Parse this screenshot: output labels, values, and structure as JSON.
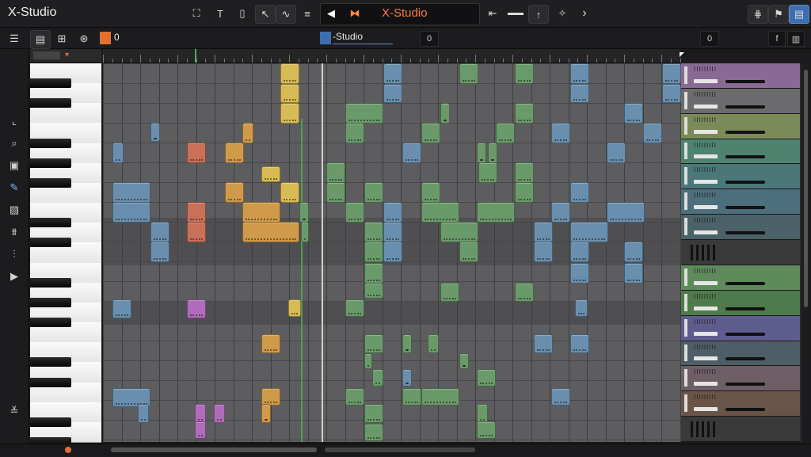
{
  "app": {
    "title": "X-Studio"
  },
  "toolbar": {
    "icons": [
      "snap-icon",
      "text-tool-icon",
      "file-icon",
      "cursor-icon",
      "wave-icon",
      "menu-icon",
      "play-back-icon",
      "play-icon",
      "rewind-icon",
      "up-icon",
      "magic-icon",
      "forward-icon",
      "split-icon",
      "flag-icon",
      "panel-icon"
    ]
  },
  "transport": {
    "title": "X-Studio"
  },
  "subbar": {
    "position": "0",
    "track_name": "-Studio",
    "field_a": "0",
    "field_b": "0",
    "fx_label": "f"
  },
  "tools": [
    "select-tool-icon",
    "zoom-tool-icon",
    "erase-tool-icon",
    "pencil-tool-icon",
    "paint-tool-icon",
    "stack-tool-icon",
    "split-tool-icon",
    "play-tool-icon",
    "collapse-tool-icon"
  ],
  "colors": {
    "blue": "#6a8fae",
    "green": "#6b9a6a",
    "orange": "#cf9a4a",
    "yellow": "#d8bb55",
    "red": "#c9705a",
    "purple": "#b06cba"
  },
  "mixer": {
    "strips": [
      {
        "label": "IIIIIIIII",
        "color": "#8a6a94"
      },
      {
        "label": "IIIIIIIII",
        "color": "#6b6b6d"
      },
      {
        "label": "IIIIIIIII",
        "color": "#7a8a58"
      },
      {
        "label": "IIIIIIIII",
        "color": "#4e8370"
      },
      {
        "label": "IIIIIIIII",
        "color": "#4a7878"
      },
      {
        "label": "IIIIIIIII",
        "color": "#4d6e7c"
      },
      {
        "label": "IIIIIIIII",
        "color": "#4a6268"
      },
      {
        "label": "",
        "color": "#3a3a3a"
      },
      {
        "label": "IIIIIIIII",
        "color": "#5e8a5c"
      },
      {
        "label": "IIIIIIIII",
        "color": "#4f7a4d"
      },
      {
        "label": "IIIIIIIII",
        "color": "#5e5c8e"
      },
      {
        "label": "IIIIIIIII",
        "color": "#4e5e66"
      },
      {
        "label": "IIIIIIIII",
        "color": "#6e5e66"
      },
      {
        "label": "IIIIIIIII",
        "color": "#6a5448"
      },
      {
        "label": "",
        "color": "#3a3a3a"
      }
    ]
  }
}
